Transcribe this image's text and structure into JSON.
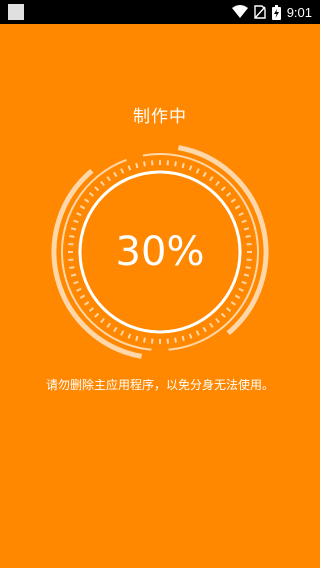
{
  "status_bar": {
    "time": "9:01",
    "icons": [
      "wifi-icon",
      "no-sim-icon",
      "battery-charging-icon"
    ]
  },
  "screen": {
    "title": "制作中",
    "progress": {
      "percent_text": "30%",
      "value": 0.3
    },
    "notice": "请勿删除主应用程序，以免分身无法使用。"
  },
  "colors": {
    "background": "#FF8800",
    "text": "#FFFFFF",
    "ring": "#FFD7A8",
    "status_bar": "#000000"
  }
}
